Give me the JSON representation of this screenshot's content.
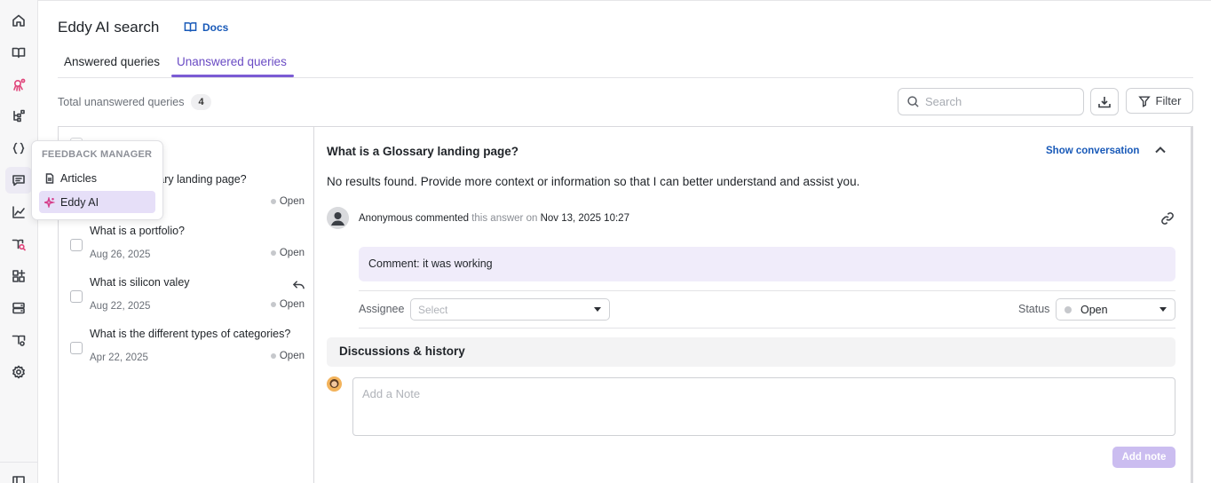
{
  "header": {
    "title": "Eddy AI search",
    "docs_label": "Docs"
  },
  "tabs": [
    {
      "label": "Answered queries"
    },
    {
      "label": "Unanswered queries",
      "active": true
    }
  ],
  "summary": {
    "total_label": "Total unanswered queries",
    "total_count": "4"
  },
  "toolbar": {
    "search_placeholder": "Search",
    "filter_label": "Filter"
  },
  "queries": [
    {
      "question": "sary landing page?",
      "date": "",
      "status": "Open"
    },
    {
      "question": "What is a portfolio?",
      "date": "Aug 26, 2025",
      "status": "Open"
    },
    {
      "question": "What is silicon valey",
      "date": "Aug 22, 2025",
      "status": "Open"
    },
    {
      "question": "What is the different types of categories?",
      "date": "Apr 22, 2025",
      "status": "Open"
    }
  ],
  "detail": {
    "question": "What is a Glossary landing page?",
    "show_conversation": "Show conversation",
    "answer": "No results found. Provide more context or information so that I can better understand and assist you.",
    "commenter": "Anonymous commented",
    "comment_mid": "this answer on",
    "comment_time": "Nov 13, 2025 10:27",
    "comment_label": "Comment:",
    "comment_text": "it was working",
    "assignee_label": "Assignee",
    "assignee_placeholder": "Select",
    "status_label": "Status",
    "status_value": "Open",
    "discussions_label": "Discussions & history",
    "note_placeholder": "Add a Note",
    "add_note_label": "Add note"
  },
  "popover": {
    "heading": "FEEDBACK MANAGER",
    "items": [
      {
        "label": "Articles",
        "icon": "document-icon"
      },
      {
        "label": "Eddy AI",
        "icon": "sparkle-icon",
        "active": true
      }
    ]
  },
  "colors": {
    "accent": "#7b5bd4",
    "link": "#1859b8",
    "comment_bg": "#f0ecfa",
    "add_note_bg": "#cbbdf0"
  }
}
